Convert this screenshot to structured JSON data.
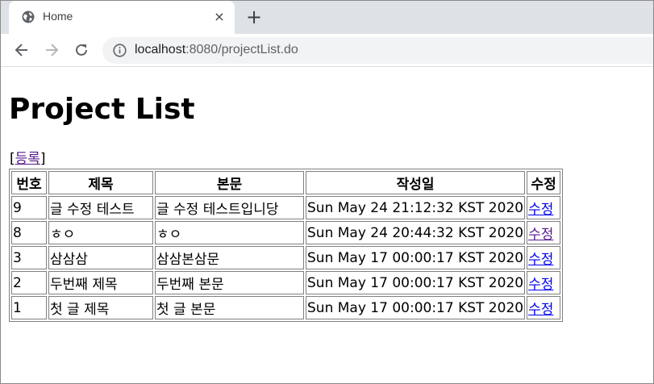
{
  "browser": {
    "tab_title": "Home",
    "tab_close": "×",
    "new_tab": "+",
    "url_host": "localhost",
    "url_rest": ":8080/projectList.do"
  },
  "page": {
    "heading": "Project List",
    "register_open": "[",
    "register_label": "등록",
    "register_close": "]",
    "table": {
      "headers": [
        "번호",
        "제목",
        "본문",
        "작성일",
        "수정"
      ],
      "rows": [
        {
          "no": "9",
          "title": "글 수정 테스트",
          "body": "글 수정 테스트입니당",
          "date": "Sun May 24 21:12:32 KST 2020",
          "edit": "수정"
        },
        {
          "no": "8",
          "title": "ㅎㅇ",
          "body": "ㅎㅇ",
          "date": "Sun May 24 20:44:32 KST 2020",
          "edit": "수정"
        },
        {
          "no": "3",
          "title": "삼삼삼",
          "body": "삼삼본삼문",
          "date": "Sun May 17 00:00:17 KST 2020",
          "edit": "수정"
        },
        {
          "no": "2",
          "title": "두번째 제목",
          "body": "두번째 본문",
          "date": "Sun May 17 00:00:17 KST 2020",
          "edit": "수정"
        },
        {
          "no": "1",
          "title": "첫 글 제목",
          "body": "첫 글 본문",
          "date": "Sun May 17 00:00:17 KST 2020",
          "edit": "수정"
        }
      ]
    }
  }
}
